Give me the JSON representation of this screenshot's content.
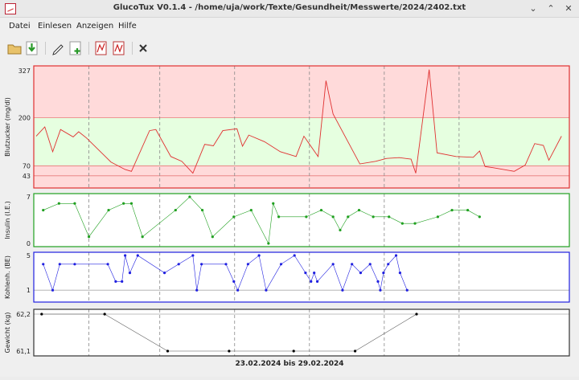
{
  "window": {
    "title": "GlucoTux V0.1.4 - /home/uja/work/Texte/Gesundheit/Messwerte/2024/2402.txt"
  },
  "menu": {
    "items": [
      "Datei",
      "Einlesen",
      "Anzeigen",
      "Hilfe"
    ]
  },
  "toolbar": {
    "icons": [
      "open-folder-icon",
      "import-icon",
      "edit-pen-icon",
      "add-document-icon",
      "report-icon",
      "report-alt-icon",
      "close-icon"
    ]
  },
  "footer": {
    "date_range": "23.02.2024 bis 29.02.2024"
  },
  "colors": {
    "glucose": "#e03030",
    "insulin": "#20a020",
    "carbs": "#2020e0",
    "weight": "#000000",
    "range_high": "#ffdada",
    "range_ok": "#e6ffe0"
  },
  "chart_data": [
    {
      "type": "line",
      "ylabel": "Blutzucker (mg/dl)",
      "yticks": [
        "327",
        "200",
        "70",
        "43"
      ],
      "ylim": [
        10,
        340
      ],
      "bands": [
        {
          "from": 200,
          "to": 340,
          "color": "range_high"
        },
        {
          "from": 70,
          "to": 200,
          "color": "range_ok"
        },
        {
          "from": 10,
          "to": 70,
          "color": "range_high"
        }
      ],
      "reference_lines": [
        70,
        43
      ],
      "series": [
        {
          "color": "glucose",
          "points": [
            [
              0.3,
              150
            ],
            [
              1.4,
              175
            ],
            [
              2.4,
              108
            ],
            [
              3.4,
              168
            ],
            [
              5.0,
              148
            ],
            [
              5.7,
              162
            ],
            [
              6.7,
              145
            ],
            [
              9.8,
              80
            ],
            [
              11.6,
              60
            ],
            [
              12.4,
              55
            ],
            [
              14.7,
              165
            ],
            [
              15.5,
              168
            ],
            [
              17.4,
              95
            ],
            [
              18.8,
              82
            ],
            [
              20.2,
              50
            ],
            [
              21.7,
              128
            ],
            [
              22.8,
              124
            ],
            [
              24.0,
              165
            ],
            [
              25.8,
              170
            ],
            [
              26.5,
              123
            ],
            [
              27.3,
              153
            ],
            [
              29.3,
              135
            ],
            [
              31.3,
              108
            ],
            [
              33.3,
              95
            ],
            [
              34.3,
              150
            ],
            [
              36.1,
              95
            ],
            [
              37.1,
              300
            ],
            [
              38.0,
              210
            ],
            [
              41.4,
              75
            ],
            [
              43.4,
              82
            ],
            [
              44.8,
              90
            ],
            [
              46.4,
              92
            ],
            [
              47.9,
              88
            ],
            [
              48.5,
              50
            ],
            [
              50.2,
              330
            ],
            [
              51.2,
              105
            ],
            [
              53.6,
              95
            ],
            [
              55.8,
              93
            ],
            [
              56.6,
              110
            ],
            [
              57.3,
              68
            ],
            [
              58.3,
              65
            ],
            [
              61.0,
              55
            ],
            [
              62.4,
              72
            ],
            [
              63.6,
              130
            ],
            [
              64.7,
              125
            ],
            [
              65.4,
              85
            ],
            [
              67.0,
              150
            ]
          ]
        }
      ]
    },
    {
      "type": "line",
      "ylabel": "Insulin (I.E.)",
      "yticks": [
        "7",
        "0"
      ],
      "ylim": [
        0,
        7
      ],
      "series": [
        {
          "color": "insulin",
          "points": [
            [
              1.2,
              5
            ],
            [
              3.2,
              6
            ],
            [
              5.2,
              6
            ],
            [
              7.0,
              1
            ],
            [
              9.5,
              5
            ],
            [
              11.4,
              6
            ],
            [
              12.4,
              6
            ],
            [
              13.8,
              1
            ],
            [
              18.0,
              5
            ],
            [
              19.8,
              7
            ],
            [
              21.4,
              5
            ],
            [
              22.7,
              1
            ],
            [
              25.4,
              4
            ],
            [
              27.6,
              5
            ],
            [
              29.8,
              0
            ],
            [
              30.4,
              6
            ],
            [
              31.1,
              4
            ],
            [
              34.6,
              4
            ],
            [
              36.5,
              5
            ],
            [
              38.0,
              4
            ],
            [
              38.9,
              2
            ],
            [
              39.9,
              4
            ],
            [
              41.3,
              5
            ],
            [
              43.1,
              4
            ],
            [
              45.1,
              4
            ],
            [
              46.8,
              3
            ],
            [
              48.4,
              3
            ],
            [
              51.3,
              4
            ],
            [
              53.1,
              5
            ],
            [
              55.1,
              5
            ],
            [
              56.6,
              4
            ]
          ]
        }
      ]
    },
    {
      "type": "line",
      "ylabel": "Kohlenh. (BE)",
      "yticks": [
        "5",
        "1"
      ],
      "ylim": [
        0,
        5
      ],
      "reference_lines": [
        1
      ],
      "series": [
        {
          "color": "carbs",
          "points": [
            [
              1.2,
              4
            ],
            [
              2.4,
              1
            ],
            [
              3.3,
              4
            ],
            [
              5.2,
              4
            ],
            [
              9.4,
              4
            ],
            [
              10.4,
              2
            ],
            [
              11.2,
              2
            ],
            [
              11.6,
              5
            ],
            [
              12.2,
              3
            ],
            [
              13.2,
              5
            ],
            [
              16.6,
              3
            ],
            [
              18.4,
              4
            ],
            [
              20.2,
              5
            ],
            [
              20.7,
              1
            ],
            [
              21.3,
              4
            ],
            [
              24.4,
              4
            ],
            [
              25.4,
              2
            ],
            [
              25.9,
              1
            ],
            [
              27.2,
              4
            ],
            [
              28.6,
              5
            ],
            [
              29.5,
              1
            ],
            [
              31.4,
              4
            ],
            [
              33.1,
              5
            ],
            [
              34.5,
              3
            ],
            [
              35.2,
              2
            ],
            [
              35.6,
              3
            ],
            [
              36.0,
              2
            ],
            [
              38.0,
              4
            ],
            [
              39.2,
              1
            ],
            [
              40.4,
              4
            ],
            [
              41.5,
              3
            ],
            [
              42.7,
              4
            ],
            [
              43.7,
              2
            ],
            [
              44.0,
              1
            ],
            [
              44.4,
              3
            ],
            [
              45.0,
              4
            ],
            [
              46.0,
              5
            ],
            [
              46.5,
              3
            ],
            [
              47.4,
              1
            ]
          ]
        }
      ]
    },
    {
      "type": "line",
      "ylabel": "Gewicht (kg)",
      "yticks": [
        "62,2",
        "61,1"
      ],
      "ylim": [
        61.1,
        62.2
      ],
      "reference_lines": [
        62.2
      ],
      "series": [
        {
          "color": "weight",
          "points": [
            [
              1.0,
              62.2
            ],
            [
              9.0,
              62.2
            ],
            [
              17.0,
              61.1
            ],
            [
              24.8,
              61.1
            ],
            [
              33.0,
              61.1
            ],
            [
              40.8,
              61.1
            ],
            [
              48.6,
              62.2
            ]
          ]
        }
      ]
    }
  ]
}
